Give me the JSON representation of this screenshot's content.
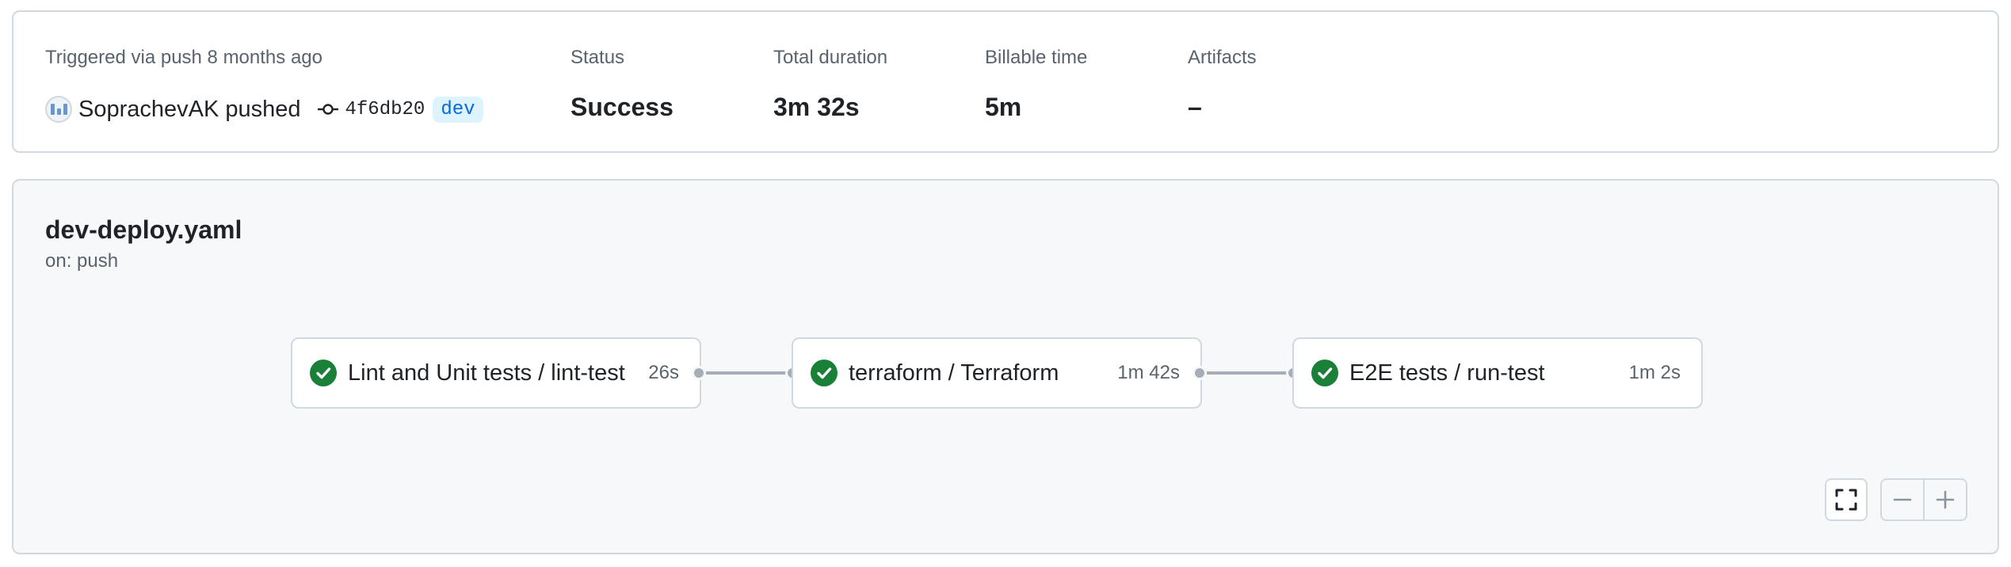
{
  "summary": {
    "trigger_label": "Triggered via push 8 months ago",
    "actor": "SoprachevAK",
    "action": "pushed",
    "commit_sha": "4f6db20",
    "branch": "dev",
    "status_label": "Status",
    "status_value": "Success",
    "duration_label": "Total duration",
    "duration_value": "3m 32s",
    "billable_label": "Billable time",
    "billable_value": "5m",
    "artifacts_label": "Artifacts",
    "artifacts_value": "–"
  },
  "workflow": {
    "file": "dev-deploy.yaml",
    "trigger": "on: push",
    "jobs": [
      {
        "name": "Lint and Unit tests / lint-test",
        "duration": "26s",
        "status": "success"
      },
      {
        "name": "terraform / Terraform",
        "duration": "1m 42s",
        "status": "success"
      },
      {
        "name": "E2E tests / run-test",
        "duration": "1m 2s",
        "status": "success"
      }
    ]
  },
  "controls": {
    "fullscreen_icon": "fullscreen-icon",
    "zoom_out_icon": "zoom-out-icon",
    "zoom_in_icon": "zoom-in-icon"
  },
  "colors": {
    "success": "#1a7f37",
    "border": "#d1d9e0",
    "muted": "#59636e",
    "branch_bg": "#ddf4ff",
    "branch_fg": "#0969da"
  }
}
